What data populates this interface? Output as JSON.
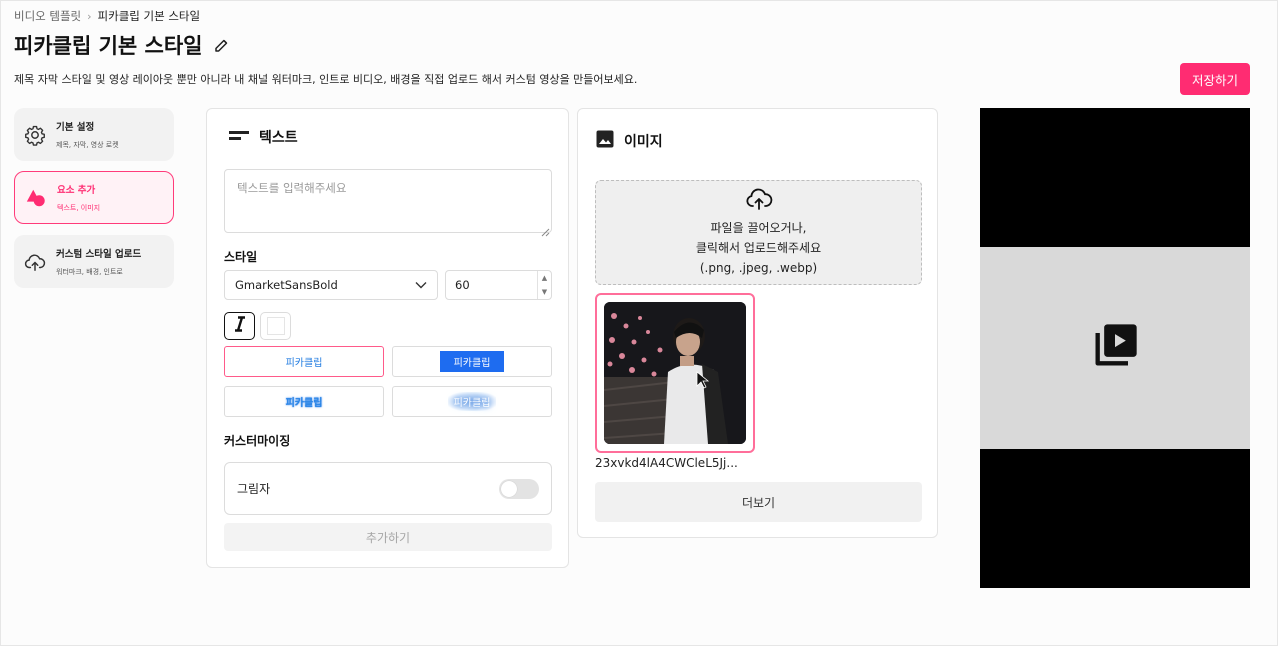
{
  "breadcrumb": {
    "parent": "비디오 템플릿",
    "current": "피카클립 기본 스타일"
  },
  "page": {
    "title": "피카클립 기본 스타일",
    "description": "제목 자막 스타일 및 영상 레이아웃 뿐만 아니라 내 채널 워터마크, 인트로 비디오, 배경을 직접 업로드 해서 커스텀 영상을 만들어보세요.",
    "save_label": "저장하기"
  },
  "nav": {
    "items": [
      {
        "title": "기본 설정",
        "sub": "제목, 자막, 영상 로켓",
        "icon": "gear-icon"
      },
      {
        "title": "요소 추가",
        "sub": "텍스트, 이미지",
        "icon": "shapes-icon",
        "active": true
      },
      {
        "title": "커스텀 스타일 업로드",
        "sub": "워터마크, 배경, 인트로",
        "icon": "cloud-upload-icon"
      }
    ]
  },
  "text_panel": {
    "title": "텍스트",
    "placeholder": "텍스트를 입력해주세요",
    "style_label": "스타일",
    "font": "GmarketSansBold",
    "size": "60",
    "style_options": [
      "피카클립",
      "피카클립",
      "피카클립",
      "피카클립"
    ],
    "custom_label": "커스터마이징",
    "shadow_label": "그림자",
    "shadow_on": false,
    "add_label": "추가하기"
  },
  "image_panel": {
    "title": "이미지",
    "drop_lines": [
      "파일을 끌어오거나,",
      "클릭해서 업로드해주세요",
      "(.png, .jpeg, .webp)"
    ],
    "file_name": "23xvkd4lA4CWCleL5Jj...",
    "more_label": "더보기"
  },
  "colors": {
    "accent": "#ff2c72",
    "highlight_blue": "#1e6cf0"
  }
}
